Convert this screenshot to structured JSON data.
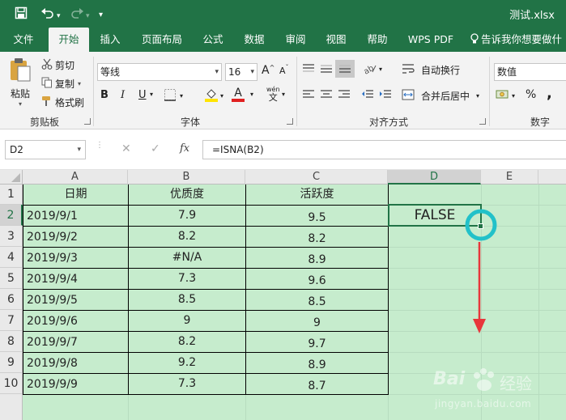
{
  "title_bar": {
    "save_icon": "save-icon",
    "undo_icon": "undo-icon",
    "redo_icon": "redo-icon",
    "customize_icon": "customize-qat-icon",
    "filename": "测试.xlsx"
  },
  "ribbon_tabs": [
    {
      "label": "文件"
    },
    {
      "label": "开始"
    },
    {
      "label": "插入"
    },
    {
      "label": "页面布局"
    },
    {
      "label": "公式"
    },
    {
      "label": "数据"
    },
    {
      "label": "审阅"
    },
    {
      "label": "视图"
    },
    {
      "label": "帮助"
    },
    {
      "label": "WPS PDF"
    },
    {
      "label": "告诉我你想要做什"
    }
  ],
  "ribbon": {
    "clipboard": {
      "paste": "粘贴",
      "cut": "剪切",
      "copy": "复制",
      "format_painter": "格式刷",
      "group_label": "剪贴板"
    },
    "font": {
      "font_name": "等线",
      "font_size": "16",
      "bold": "B",
      "italic": "I",
      "underline": "U",
      "grow": "A",
      "shrink": "A",
      "font_color_letter": "A",
      "phonetic": "wén",
      "phonetic_letter": "文",
      "group_label": "字体"
    },
    "alignment": {
      "wrap_text": "自动换行",
      "merge_center": "合并后居中",
      "group_label": "对齐方式"
    },
    "number": {
      "format": "数值",
      "percent": "%",
      "group_label": "数字"
    }
  },
  "formula_bar": {
    "name_box": "D2",
    "cancel": "✕",
    "enter": "✓",
    "fx": "fx",
    "formula": "=ISNA(B2)"
  },
  "sheet": {
    "columns": [
      "A",
      "B",
      "C",
      "D",
      "E"
    ],
    "rows": [
      "1",
      "2",
      "3",
      "4",
      "5",
      "6",
      "7",
      "8",
      "9",
      "10"
    ],
    "headers": [
      "日期",
      "优质度",
      "活跃度"
    ],
    "data": [
      [
        "2019/9/1",
        "7.9",
        "9.5"
      ],
      [
        "2019/9/2",
        "8.2",
        "8.2"
      ],
      [
        "2019/9/3",
        "#N/A",
        "8.9"
      ],
      [
        "2019/9/4",
        "7.3",
        "9.6"
      ],
      [
        "2019/9/5",
        "8.5",
        "8.5"
      ],
      [
        "2019/9/6",
        "9",
        "9"
      ],
      [
        "2019/9/7",
        "8.2",
        "9.7"
      ],
      [
        "2019/9/8",
        "9.2",
        "8.9"
      ],
      [
        "2019/9/9",
        "7.3",
        "8.7"
      ]
    ],
    "d2_value": "FALSE",
    "selected_cell": "D2"
  },
  "annotations": {
    "circle_color": "#22c1c9",
    "arrow_color": "#e8363b"
  },
  "watermark": {
    "brand": "Bai",
    "brand_cn": "经验",
    "url": "jingyan.baidu.com"
  },
  "colors": {
    "excel_green": "#217346",
    "sheet_fill": "#c6eccd"
  }
}
